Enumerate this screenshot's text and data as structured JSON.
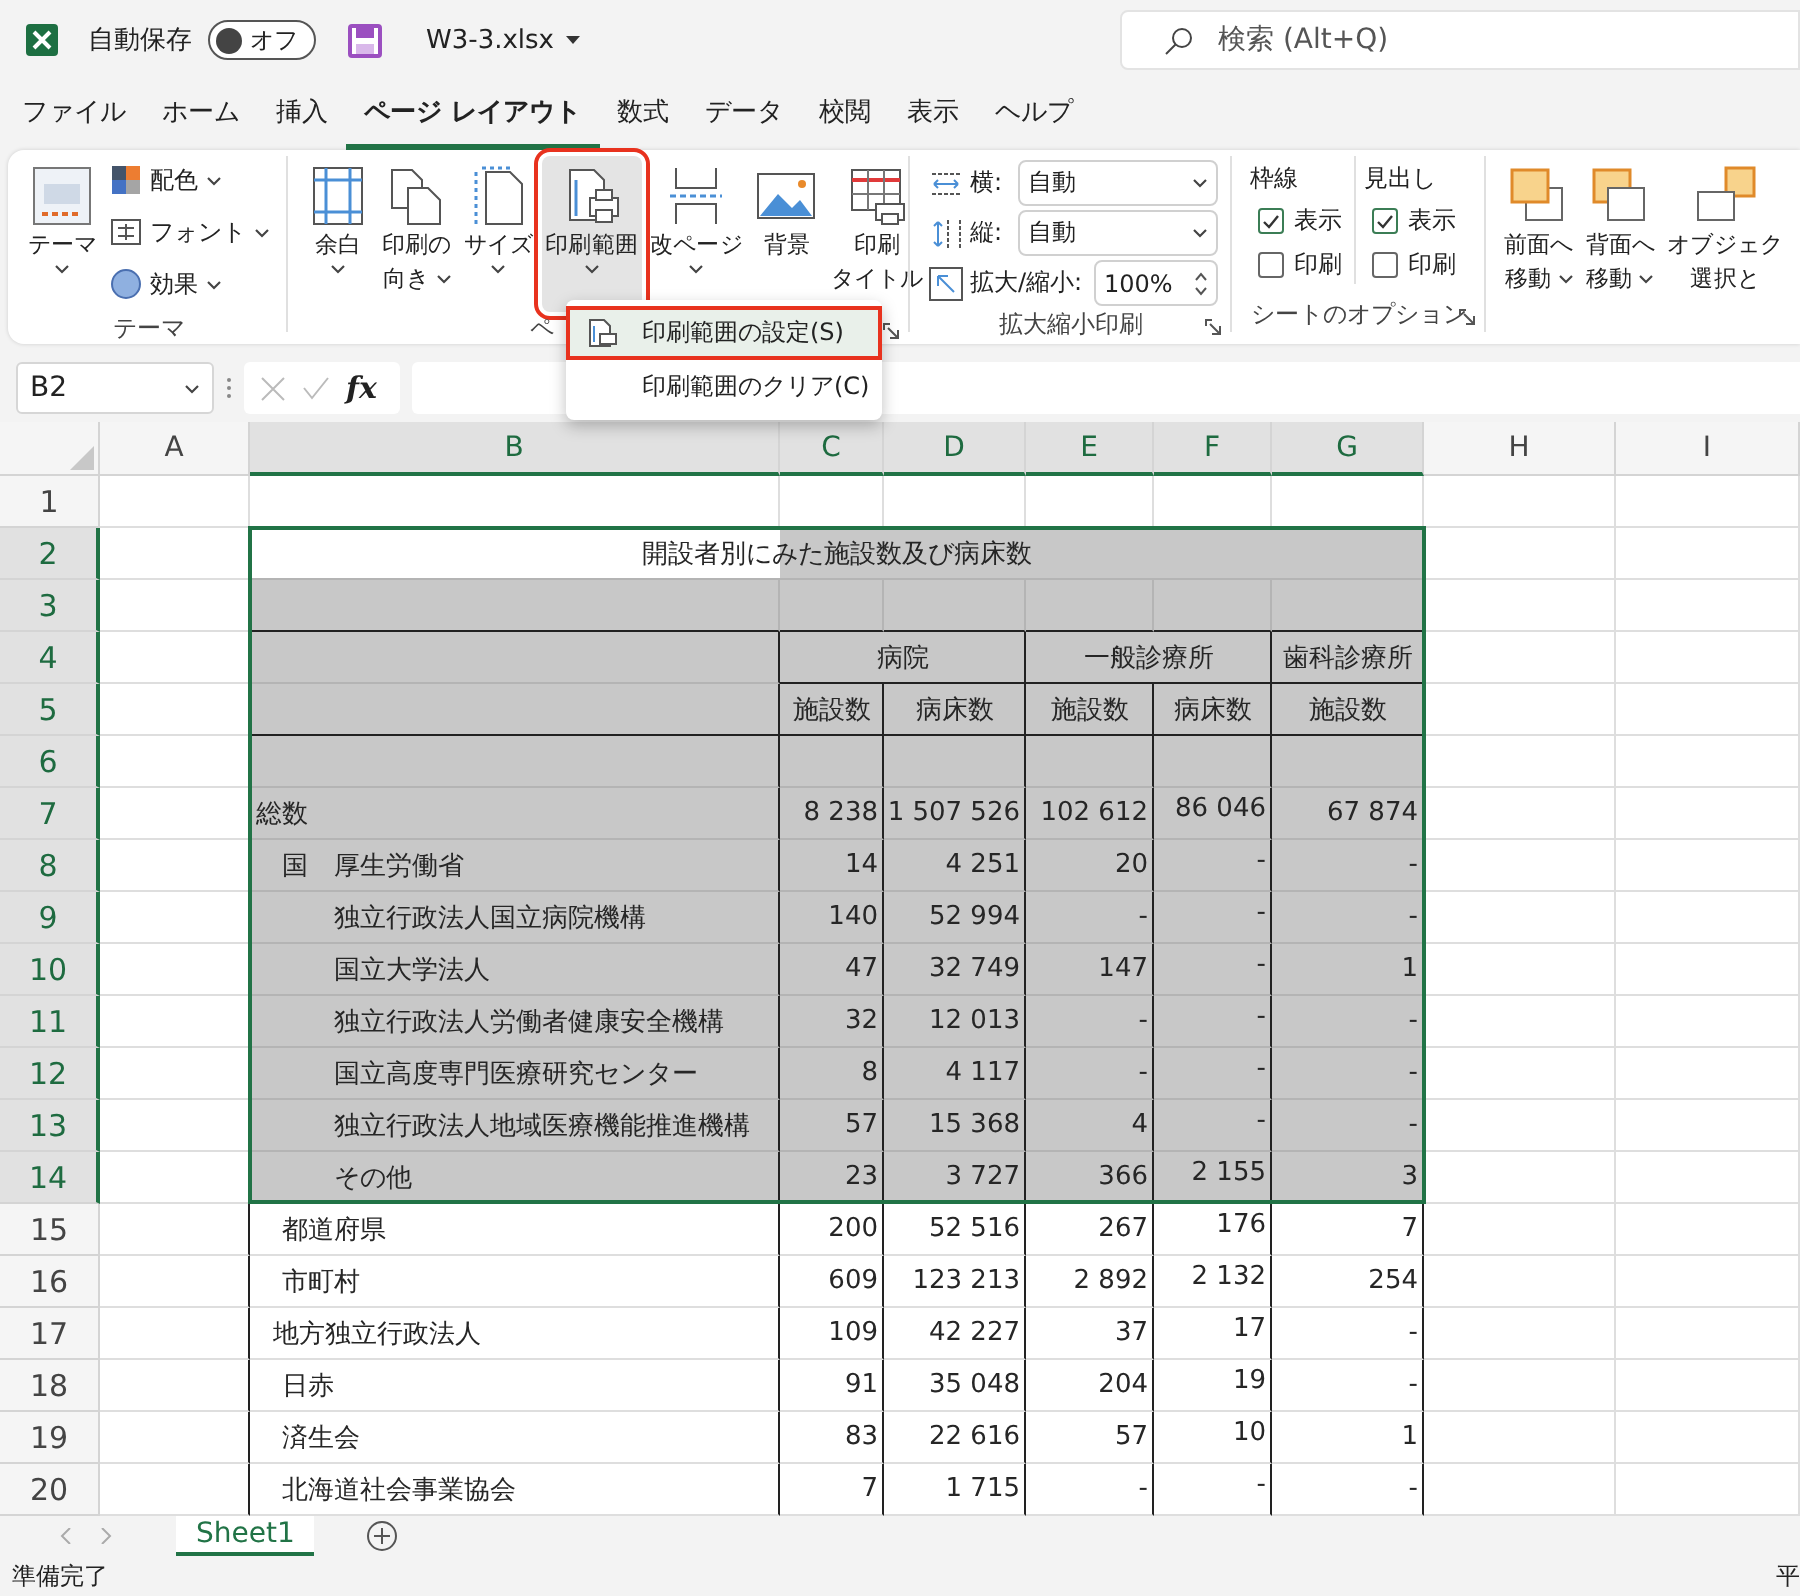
{
  "title_bar": {
    "autosave_label": "自動保存",
    "autosave": {
      "on": false,
      "label": "オフ"
    },
    "file_name": "W3-3.xlsx",
    "search_placeholder": "検索 (Alt+Q)"
  },
  "menu_tabs": [
    {
      "label": "ファイル",
      "selected": false
    },
    {
      "label": "ホーム",
      "selected": false
    },
    {
      "label": "挿入",
      "selected": false
    },
    {
      "label": "ページ レイアウト",
      "selected": true
    },
    {
      "label": "数式",
      "selected": false
    },
    {
      "label": "データ",
      "selected": false
    },
    {
      "label": "校閲",
      "selected": false
    },
    {
      "label": "表示",
      "selected": false
    },
    {
      "label": "ヘルプ",
      "selected": false
    }
  ],
  "ribbon": {
    "groups": [
      {
        "kind": "theme",
        "label": "テーマ",
        "big": {
          "lines": [
            "テーマ"
          ],
          "dropdown": true,
          "highlighted": false
        },
        "items": [
          {
            "label": "配色"
          },
          {
            "label": "フォント"
          },
          {
            "label": "効果"
          }
        ]
      },
      {
        "kind": "page_setup",
        "label": "ペ",
        "buttons": [
          {
            "lines": [
              "余白"
            ],
            "dropdown": true,
            "highlighted": false
          },
          {
            "lines": [
              "印刷の",
              "向き"
            ],
            "dropdown": true,
            "highlighted": false
          },
          {
            "lines": [
              "サイズ"
            ],
            "dropdown": true,
            "highlighted": false
          },
          {
            "lines": [
              "印刷範囲"
            ],
            "dropdown": true,
            "highlighted": true
          },
          {
            "lines": [
              "改ページ"
            ],
            "dropdown": true,
            "highlighted": false
          },
          {
            "lines": [
              "背景"
            ],
            "dropdown": false,
            "highlighted": false
          },
          {
            "lines": [
              "印刷",
              "タイトル"
            ],
            "dropdown": false,
            "highlighted": false
          }
        ]
      },
      {
        "kind": "scale",
        "label": "拡大縮小印刷",
        "rows": [
          {
            "kind": "select",
            "label": "横:",
            "value": "自動"
          },
          {
            "kind": "select",
            "label": "縦:",
            "value": "自動"
          },
          {
            "kind": "spin",
            "label": "拡大/縮小:",
            "value": "100%"
          }
        ]
      },
      {
        "kind": "sheet_options",
        "label": "シートのオプション",
        "columns": [
          {
            "title": "枠線",
            "options": [
              {
                "label": "表示",
                "checked": true
              },
              {
                "label": "印刷",
                "checked": false
              }
            ]
          },
          {
            "title": "見出し",
            "options": [
              {
                "label": "表示",
                "checked": true
              },
              {
                "label": "印刷",
                "checked": false
              }
            ]
          }
        ]
      },
      {
        "kind": "arrange",
        "buttons": [
          {
            "lines": [
              "前面へ",
              "移動"
            ],
            "dropdown": true,
            "highlighted": false
          },
          {
            "lines": [
              "背面へ",
              "移動"
            ],
            "dropdown": true,
            "highlighted": false
          },
          {
            "lines": [
              "オブジェク",
              "選択と"
            ],
            "dropdown": false,
            "highlighted": false
          }
        ]
      }
    ]
  },
  "dropdown_menu": {
    "items": [
      {
        "label": "印刷範囲の設定(S)",
        "highlighted": true
      },
      {
        "label": "印刷範囲のクリア(C)",
        "highlighted": false
      }
    ]
  },
  "formula_bar": {
    "cell_ref": "B2",
    "function_label": "fx"
  },
  "sheet": {
    "columns": [
      {
        "label": "A",
        "selected": false
      },
      {
        "label": "B",
        "selected": true
      },
      {
        "label": "C",
        "selected": true
      },
      {
        "label": "D",
        "selected": true
      },
      {
        "label": "E",
        "selected": true
      },
      {
        "label": "F",
        "selected": true
      },
      {
        "label": "G",
        "selected": true
      },
      {
        "label": "H",
        "selected": false
      },
      {
        "label": "I",
        "selected": false
      }
    ],
    "rows": [
      {
        "number": "1",
        "selected": false,
        "kind": "blank"
      },
      {
        "number": "2",
        "selected": true,
        "kind": "title",
        "cells": [
          "開設者別にみた施設数及び病床数"
        ]
      },
      {
        "number": "3",
        "selected": true,
        "kind": "blank"
      },
      {
        "number": "4",
        "selected": true,
        "kind": "group_header",
        "cells": [
          "病院",
          "一般診療所",
          "歯科診療所"
        ]
      },
      {
        "number": "5",
        "selected": true,
        "kind": "sub_header",
        "cells": [
          "施設数",
          "病床数",
          "施設数",
          "病床数",
          "施設数"
        ]
      },
      {
        "number": "6",
        "selected": true,
        "kind": "blank"
      },
      {
        "number": "7",
        "selected": true,
        "kind": "data",
        "cells": [
          "総数",
          "8 238",
          "1 507 526",
          "102 612",
          "86 046",
          "67 874"
        ]
      },
      {
        "number": "8",
        "selected": true,
        "kind": "data",
        "cells": [
          "　国　厚生労働省",
          "14",
          "4 251",
          "20",
          "-",
          "-"
        ]
      },
      {
        "number": "9",
        "selected": true,
        "kind": "data",
        "cells": [
          "　　　独立行政法人国立病院機構",
          "140",
          "52 994",
          "-",
          "-",
          "-"
        ]
      },
      {
        "number": "10",
        "selected": true,
        "kind": "data",
        "cells": [
          "　　　国立大学法人",
          "47",
          "32 749",
          "147",
          "-",
          "1"
        ]
      },
      {
        "number": "11",
        "selected": true,
        "kind": "data",
        "cells": [
          "　　　独立行政法人労働者健康安全機構",
          "32",
          "12 013",
          "-",
          "-",
          "-"
        ]
      },
      {
        "number": "12",
        "selected": true,
        "kind": "data",
        "cells": [
          "　　　国立高度専門医療研究センター",
          "8",
          "4 117",
          "-",
          "-",
          "-"
        ]
      },
      {
        "number": "13",
        "selected": true,
        "kind": "data",
        "cells": [
          "　　　独立行政法人地域医療機能推進機構",
          "57",
          "15 368",
          "4",
          "-",
          "-"
        ]
      },
      {
        "number": "14",
        "selected": true,
        "kind": "data",
        "cells": [
          "　　　その他",
          "23",
          "3 727",
          "366",
          "2 155",
          "3"
        ]
      },
      {
        "number": "15",
        "selected": false,
        "kind": "data",
        "cells": [
          "　都道府県",
          "200",
          "52 516",
          "267",
          "176",
          "7"
        ]
      },
      {
        "number": "16",
        "selected": false,
        "kind": "data",
        "cells": [
          "　市町村",
          "609",
          "123 213",
          "2 892",
          "2 132",
          "254"
        ]
      },
      {
        "number": "17",
        "selected": false,
        "kind": "data",
        "cells": [
          "  地方独立行政法人",
          "109",
          "42 227",
          "37",
          "17",
          "-"
        ]
      },
      {
        "number": "18",
        "selected": false,
        "kind": "data",
        "cells": [
          "　日赤",
          "91",
          "35 048",
          "204",
          "19",
          "-"
        ]
      },
      {
        "number": "19",
        "selected": false,
        "kind": "data",
        "cells": [
          "　済生会",
          "83",
          "22 616",
          "57",
          "10",
          "1"
        ]
      },
      {
        "number": "20",
        "selected": false,
        "kind": "data",
        "cells": [
          "　北海道社会事業協会",
          "7",
          "1 715",
          "-",
          "-",
          "-"
        ]
      }
    ]
  },
  "sheet_tabs": [
    {
      "label": "Sheet1",
      "selected": true
    }
  ],
  "status_bar": {
    "left": "準備完了",
    "right": "平"
  }
}
